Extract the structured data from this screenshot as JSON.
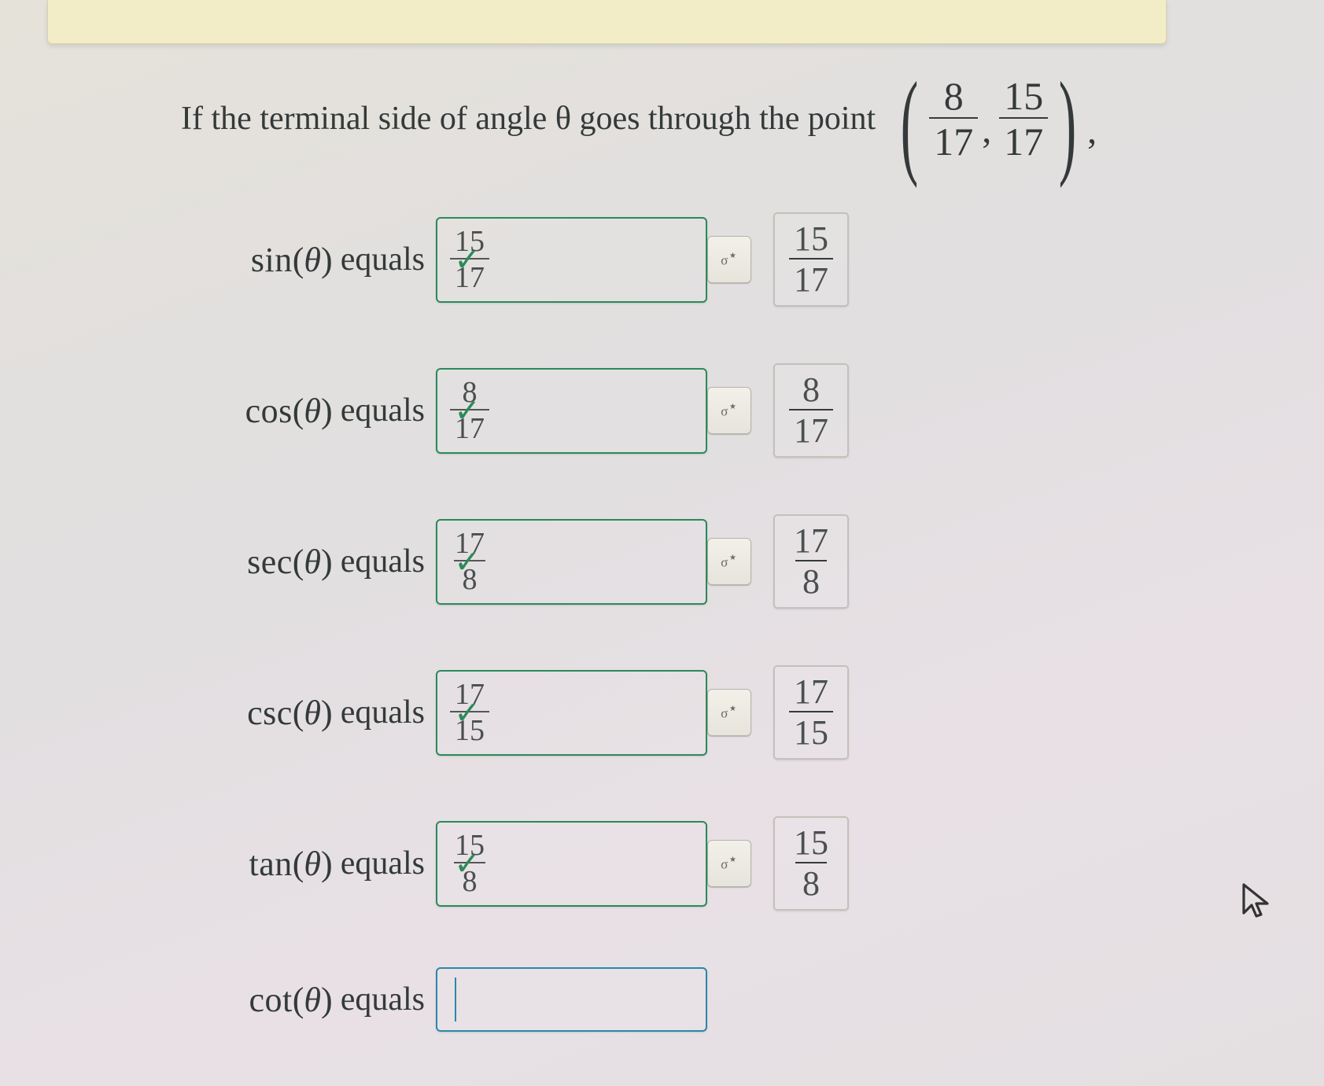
{
  "question": {
    "text": "If the terminal side of angle θ goes through the point",
    "point": {
      "x_num": "8",
      "x_den": "17",
      "y_num": "15",
      "y_den": "17"
    }
  },
  "rows": [
    {
      "fn": "sin",
      "equals": "equals",
      "input_num": "15",
      "input_den": "17",
      "preview_num": "15",
      "preview_den": "17",
      "correct": true
    },
    {
      "fn": "cos",
      "equals": "equals",
      "input_num": "8",
      "input_den": "17",
      "preview_num": "8",
      "preview_den": "17",
      "correct": true
    },
    {
      "fn": "sec",
      "equals": "equals",
      "input_num": "17",
      "input_den": "8",
      "preview_num": "17",
      "preview_den": "8",
      "correct": true
    },
    {
      "fn": "csc",
      "equals": "equals",
      "input_num": "17",
      "input_den": "15",
      "preview_num": "17",
      "preview_den": "15",
      "correct": true
    },
    {
      "fn": "tan",
      "equals": "equals",
      "input_num": "15",
      "input_den": "8",
      "preview_num": "15",
      "preview_den": "8",
      "correct": true
    },
    {
      "fn": "cot",
      "equals": "equals",
      "input_num": "",
      "input_den": "",
      "preview_num": "",
      "preview_den": "",
      "correct": null,
      "empty": true
    }
  ],
  "check_glyph": "✓",
  "toolbox_glyph": "⚙"
}
